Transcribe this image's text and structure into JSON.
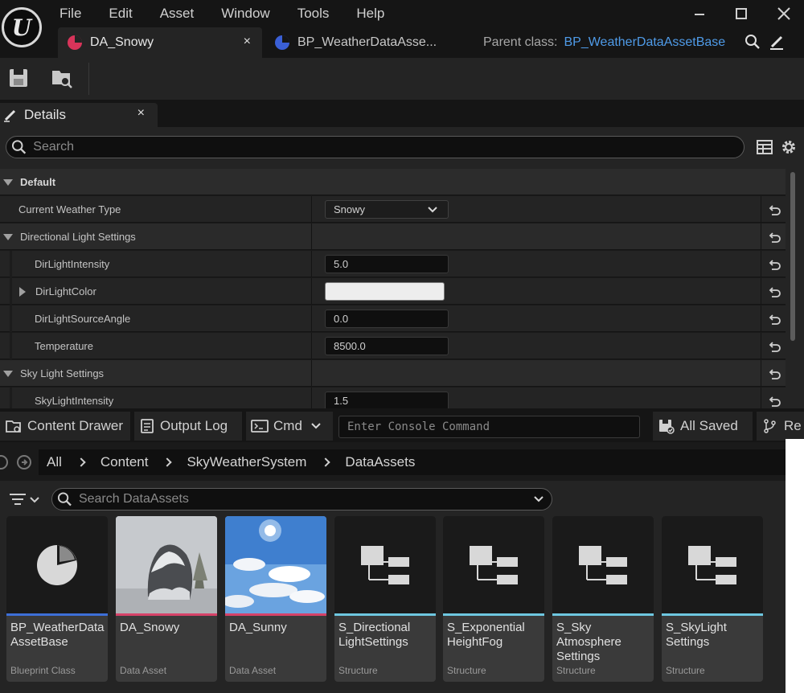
{
  "menu": [
    "File",
    "Edit",
    "Asset",
    "Window",
    "Tools",
    "Help"
  ],
  "tabs": [
    {
      "label": "DA_Snowy",
      "close": "×"
    },
    {
      "label": "BP_WeatherDataAsse..."
    }
  ],
  "parent_class": {
    "label": "Parent class:",
    "value": "BP_WeatherDataAssetBase"
  },
  "details": {
    "tab_label": "Details",
    "tab_close": "×",
    "search_placeholder": "Search",
    "rows": [
      {
        "name": "Default"
      },
      {
        "name": "Current Weather Type",
        "value": "Snowy"
      },
      {
        "name": "Directional Light Settings"
      },
      {
        "name": "DirLightIntensity",
        "value": "5.0"
      },
      {
        "name": "DirLightColor",
        "color": "#ededed"
      },
      {
        "name": "DirLightSourceAngle",
        "value": "0.0"
      },
      {
        "name": "Temperature",
        "value": "8500.0"
      },
      {
        "name": "Sky Light Settings"
      },
      {
        "name": "SkyLightIntensity",
        "value": "1.5"
      }
    ]
  },
  "bottom_bar": {
    "content_drawer": "Content Drawer",
    "output_log": "Output Log",
    "cmd": "Cmd",
    "console_placeholder": "Enter Console Command",
    "all_saved": "All Saved",
    "revision": "Re"
  },
  "content_browser": {
    "breadcrumbs": [
      "All",
      "Content",
      "SkyWeatherSystem",
      "DataAssets"
    ],
    "search_placeholder": "Search DataAssets",
    "assets": [
      {
        "name": "BP_WeatherData AssetBase",
        "type": "Blueprint Class",
        "stripe": "#3d6fd8",
        "icon": "data-asset-pie-icon"
      },
      {
        "name": "DA_Snowy",
        "type": "Data Asset",
        "stripe": "#d64268",
        "icon": "snowy-rock-thumbnail"
      },
      {
        "name": "DA_Sunny",
        "type": "Data Asset",
        "stripe": "#d64268",
        "icon": "sunny-sky-thumbnail"
      },
      {
        "name": "S_Directional LightSettings",
        "type": "Structure",
        "stripe": "#6ec7e0",
        "icon": "structure-icon"
      },
      {
        "name": "S_Exponential HeightFog",
        "type": "Structure",
        "stripe": "#6ec7e0",
        "icon": "structure-icon"
      },
      {
        "name": "S_Sky Atmosphere Settings",
        "type": "Structure",
        "stripe": "#6ec7e0",
        "icon": "structure-icon"
      },
      {
        "name": "S_SkyLight Settings",
        "type": "Structure",
        "stripe": "#6ec7e0",
        "icon": "structure-icon"
      }
    ]
  }
}
